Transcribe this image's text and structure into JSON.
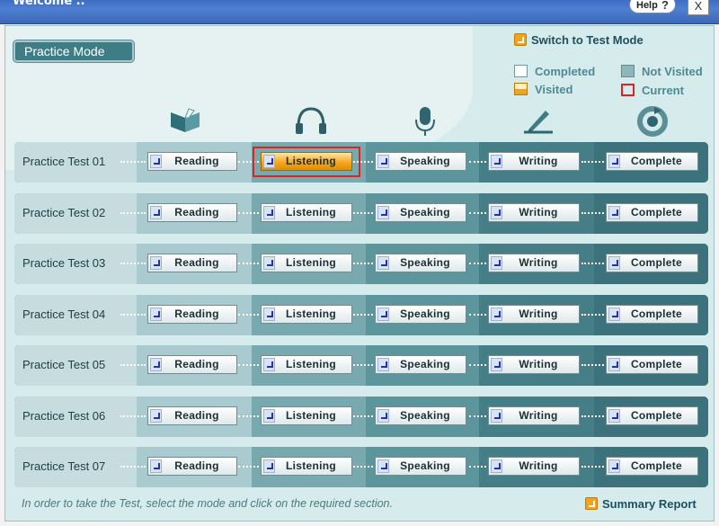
{
  "window": {
    "title": "Welcome ..",
    "help_label": "Help",
    "help_symbol": "?",
    "close_symbol": "X"
  },
  "header": {
    "mode_badge": "Practice Mode",
    "switch_link": "Switch to Test Mode"
  },
  "legend": {
    "completed": "Completed",
    "not_visited": "Not Visited",
    "visited": "Visited",
    "current": "Current"
  },
  "section_icons": [
    "book-icon",
    "headphones-icon",
    "microphone-icon",
    "pen-icon",
    "complete-cycle-icon"
  ],
  "rows": [
    {
      "label": "Practice Test 01",
      "sections": [
        "Reading",
        "Listening",
        "Speaking",
        "Writing",
        "Complete"
      ],
      "visited": [
        1
      ],
      "current": 1
    },
    {
      "label": "Practice Test 02",
      "sections": [
        "Reading",
        "Listening",
        "Speaking",
        "Writing",
        "Complete"
      ],
      "visited": [],
      "current": null
    },
    {
      "label": "Practice Test 03",
      "sections": [
        "Reading",
        "Listening",
        "Speaking",
        "Writing",
        "Complete"
      ],
      "visited": [],
      "current": null
    },
    {
      "label": "Practice Test 04",
      "sections": [
        "Reading",
        "Listening",
        "Speaking",
        "Writing",
        "Complete"
      ],
      "visited": [],
      "current": null
    },
    {
      "label": "Practice Test 05",
      "sections": [
        "Reading",
        "Listening",
        "Speaking",
        "Writing",
        "Complete"
      ],
      "visited": [],
      "current": null
    },
    {
      "label": "Practice Test 06",
      "sections": [
        "Reading",
        "Listening",
        "Speaking",
        "Writing",
        "Complete"
      ],
      "visited": [],
      "current": null
    },
    {
      "label": "Practice Test 07",
      "sections": [
        "Reading",
        "Listening",
        "Speaking",
        "Writing",
        "Complete"
      ],
      "visited": [],
      "current": null
    }
  ],
  "footer": {
    "instruction": "In order to take the Test, select the mode and click on the required section.",
    "summary_link": "Summary Report"
  },
  "colors": {
    "accent_orange": "#f3a21b",
    "current_red": "#dd2222",
    "teal_dark": "#3e7d86",
    "app_bg": "#d6ebec"
  }
}
